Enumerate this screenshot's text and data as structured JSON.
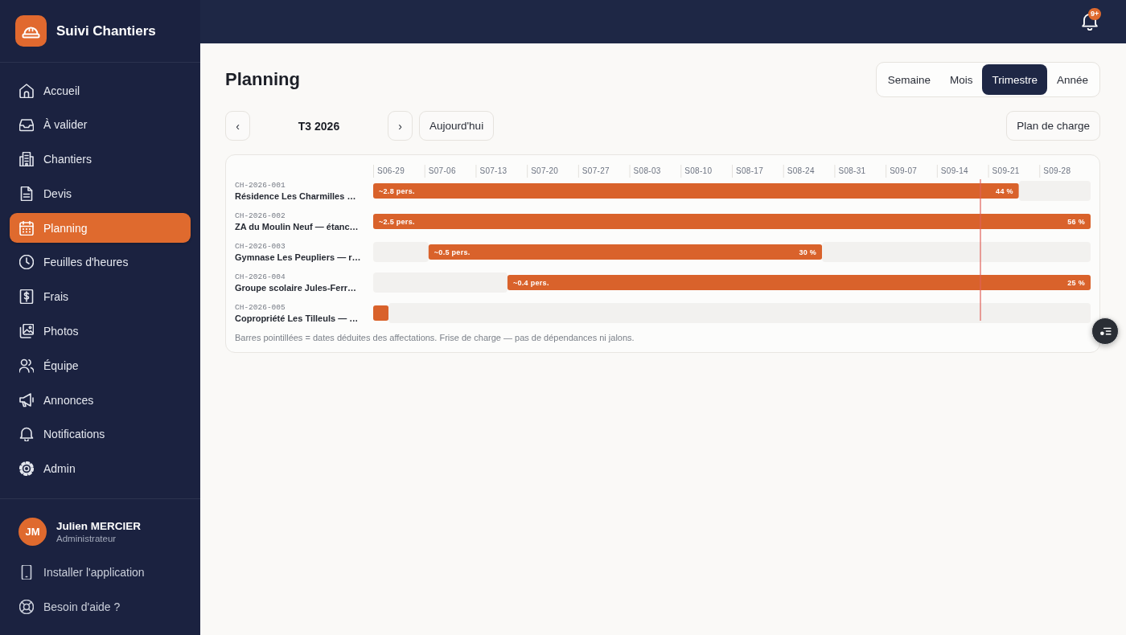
{
  "sidebar": {
    "brand": "Suivi Chantiers",
    "items": [
      {
        "label": "Accueil",
        "selected": false
      },
      {
        "label": "À valider",
        "selected": false
      },
      {
        "label": "Chantiers",
        "selected": false
      },
      {
        "label": "Devis",
        "selected": false
      },
      {
        "label": "Planning",
        "selected": true
      },
      {
        "label": "Feuilles d'heures",
        "selected": false
      },
      {
        "label": "Frais",
        "selected": false
      },
      {
        "label": "Photos",
        "selected": false
      },
      {
        "label": "Équipe",
        "selected": false
      },
      {
        "label": "Annonces",
        "selected": false
      },
      {
        "label": "Notifications",
        "selected": false
      },
      {
        "label": "Admin",
        "selected": false
      }
    ],
    "user": {
      "initials": "JM",
      "name": "Julien MERCIER",
      "role": "Administrateur"
    },
    "links": [
      "Installer l'application",
      "Besoin d'aide ?"
    ]
  },
  "top_bar": {
    "notification_badge": "9+"
  },
  "page": {
    "title": "Planning",
    "views": [
      {
        "label": "Semaine",
        "selected": false
      },
      {
        "label": "Mois",
        "selected": false
      },
      {
        "label": "Trimestre",
        "selected": true
      },
      {
        "label": "Année",
        "selected": false
      }
    ],
    "prev": "‹",
    "period": "T3 2026",
    "next": "›",
    "today": "Aujourd'hui",
    "load_plan": "Plan de charge"
  },
  "planning": {
    "weeks": [
      "S06-29",
      "S07-06",
      "S07-13",
      "S07-20",
      "S07-27",
      "S08-03",
      "S08-10",
      "S08-17",
      "S08-24",
      "S08-31",
      "S09-07",
      "S09-14",
      "S09-21",
      "S09-28"
    ],
    "rows": [
      {
        "code": "CH-2026-001",
        "name": "Résidence Les Charmilles …",
        "load": "~2.8 pers.",
        "progress": "44 %"
      },
      {
        "code": "CH-2026-002",
        "name": "ZA du Moulin Neuf — étanc…",
        "load": "~2.5 pers.",
        "progress": "56 %"
      },
      {
        "code": "CH-2026-003",
        "name": "Gymnase Les Peupliers — r…",
        "load": "~0.5 pers.",
        "progress": "30 %"
      },
      {
        "code": "CH-2026-004",
        "name": "Groupe scolaire Jules-Ferr…",
        "load": "~0.4 pers.",
        "progress": "25 %"
      },
      {
        "code": "CH-2026-005",
        "name": "Copropriété Les Tilleuls — …"
      }
    ],
    "note": "Barres pointillées = dates déduites des affectations. Frise de charge — pas de dépendances ni jalons."
  }
}
